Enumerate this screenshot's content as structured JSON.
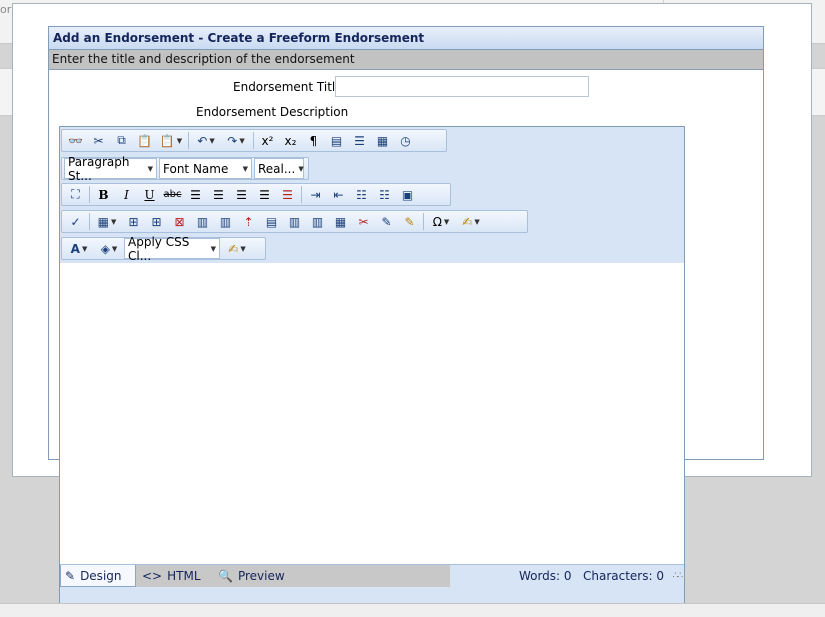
{
  "background": {
    "corner_text": "or"
  },
  "dialog": {
    "header": "Add an Endorsement - Create a Freeform Endorsement",
    "subheader": "Enter the title and description of the endorsement",
    "title_label": "Endorsement Title",
    "title_value": "",
    "description_label": "Endorsement Description"
  },
  "editor": {
    "dropdowns": {
      "paragraph": "Paragraph St...",
      "font": "Font Name",
      "size": "Real...",
      "css_class": "Apply CSS Cl..."
    },
    "toolbar_icons": {
      "find": "find-replace-icon",
      "cut": "cut-icon",
      "copy": "copy-icon",
      "paste": "paste-icon",
      "undo": "undo-icon",
      "redo": "redo-icon",
      "superscript": "superscript-icon",
      "subscript": "subscript-icon",
      "paragraph_mark": "pilcrow-icon",
      "spell_check": "spell-check-icon",
      "symbol": "omega-icon"
    },
    "modes": {
      "design": "Design",
      "html": "HTML",
      "preview": "Preview"
    },
    "words_label": "Words: 0",
    "chars_label": "Characters: 0"
  }
}
